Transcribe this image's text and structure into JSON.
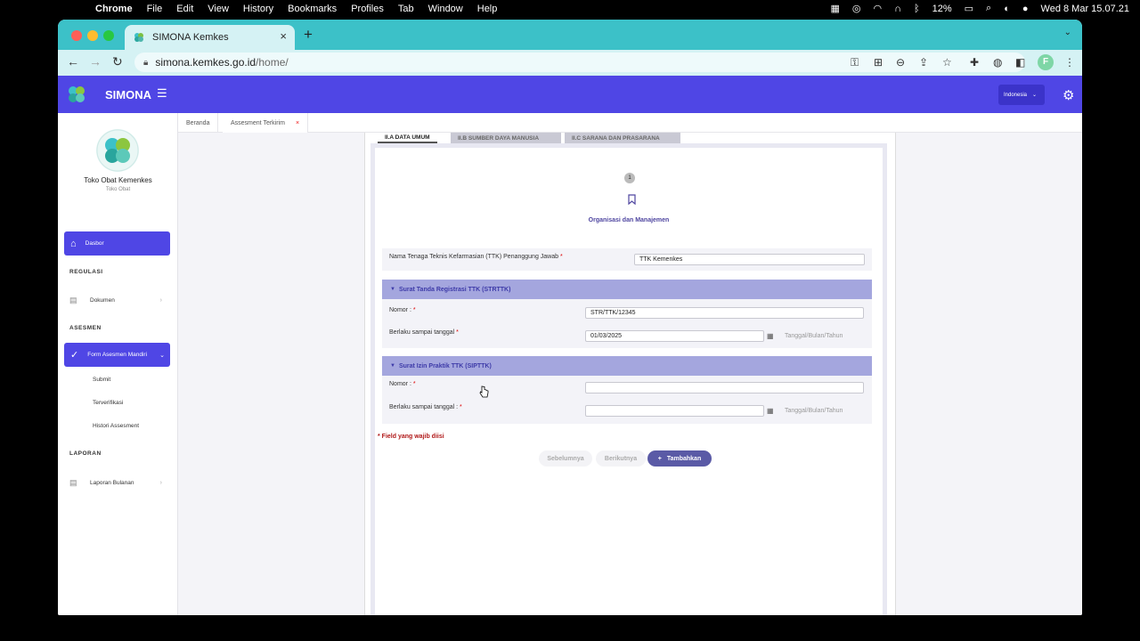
{
  "menubar": {
    "app": "Chrome",
    "items": [
      "File",
      "Edit",
      "View",
      "History",
      "Bookmarks",
      "Profiles",
      "Tab",
      "Window",
      "Help"
    ],
    "battery": "12%",
    "clock": "Wed 8 Mar  15.07.21"
  },
  "browser": {
    "tab_title": "SIMONA Kemkes",
    "url_host": "simona.kemkes.go.id",
    "url_path": "/home/",
    "colors": {
      "tabstrip": "#3cc1c8",
      "toolbar": "#d5f2f4"
    }
  },
  "app": {
    "brand": "SIMONA",
    "language": "Indonesia",
    "accent": "#4f46e5"
  },
  "sidebar": {
    "store_name": "Toko Obat Kemenkes",
    "store_type": "Toko Obat",
    "dashboard": "Dasbor",
    "section_regulasi": "REGULASI",
    "dokumen": "Dokumen",
    "section_asesmen": "ASESMEN",
    "form_asesmen": "Form Asesmen Mandiri",
    "sub_submit": "Submit",
    "sub_terverifikasi": "Terverifikasi",
    "sub_histori": "Histori Assesment",
    "section_laporan": "LAPORAN",
    "laporan_bulanan": "Laporan Bulanan"
  },
  "pagetabs": {
    "home": "Beranda",
    "current": "Assesment Terkirim",
    "close": "×"
  },
  "section_tabs": {
    "a": "II.A DATA UMUM",
    "b": "II.B SUMBER DAYA MANUSIA",
    "c": "II.C SARANA DAN PRASARANA"
  },
  "step": {
    "number": "1",
    "label": "Organisasi dan Manajemen"
  },
  "form": {
    "ttk_label": "Nama Tenaga Teknis Kefarmasian (TTK) Penanggung Jawab",
    "ttk_value": "TTK Kemenkes",
    "required_mark": "*",
    "strttk_header": "Surat Tanda Registrasi TTK (STRTTK)",
    "strttk_nomor_label": "Nomor :",
    "strttk_nomor_value": "STR/TTK/12345",
    "strttk_berlaku_label": "Berlaku sampai tanggal",
    "strttk_berlaku_value": "01/03/2025",
    "date_hint": "Tanggal/Bulan/Tahun",
    "sipttk_header": "Surat Izin Praktik TTK (SIPTTK)",
    "sipttk_nomor_label": "Nomor :",
    "sipttk_nomor_value": "",
    "sipttk_berlaku_label": "Berlaku sampai tanggal :",
    "sipttk_berlaku_value": "",
    "required_note": "* Field yang wajib diisi"
  },
  "buttons": {
    "prev": "Sebelumnya",
    "next": "Berikutnya",
    "add": "Tambahkan"
  }
}
